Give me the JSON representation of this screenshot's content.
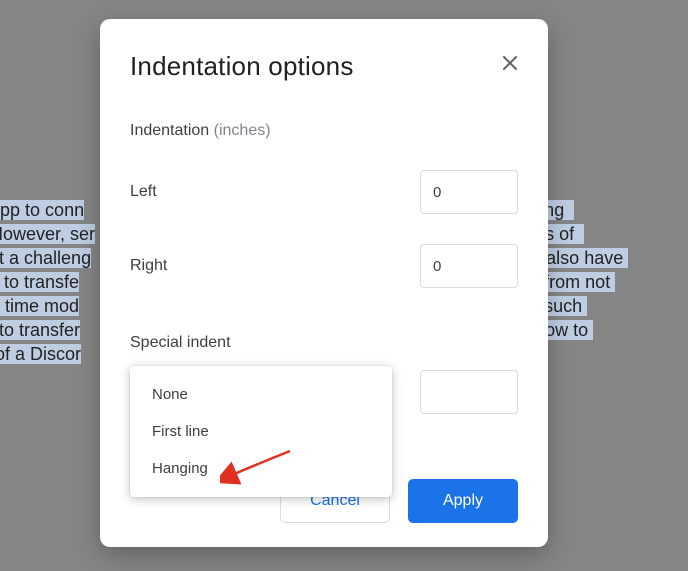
{
  "background_lines": [
    {
      "pre": "  ",
      "hl": "app to conn",
      "post": "",
      "tail": "ring  "
    },
    {
      "pre": "  ",
      "hl": "However, ser",
      "post": "",
      "tail": "s of  "
    },
    {
      "pre": "",
      "hl": "g it a challeng",
      "post": "",
      "tail": " also have "
    },
    {
      "pre": "",
      "hl": "ns to transfe",
      "post": "",
      "tail": "e from not "
    },
    {
      "pre": "",
      "hl": "nd time mod",
      "post": "",
      "tail": "n such "
    },
    {
      "pre": "",
      "hl": "le to transfer",
      "post": "",
      "tail": " how to "
    },
    {
      "pre": "",
      "hl": "p of a Discor",
      "post": "",
      "tail": ""
    }
  ],
  "modal": {
    "title": "Indentation options",
    "section": {
      "label": "Indentation",
      "unit": "(inches)"
    },
    "left": {
      "label": "Left",
      "value": "0"
    },
    "right": {
      "label": "Right",
      "value": "0"
    },
    "special": {
      "label": "Special indent",
      "value": ""
    },
    "dropdown": {
      "items": [
        "None",
        "First line",
        "Hanging"
      ]
    },
    "actions": {
      "cancel": "Cancel",
      "apply": "Apply"
    }
  }
}
